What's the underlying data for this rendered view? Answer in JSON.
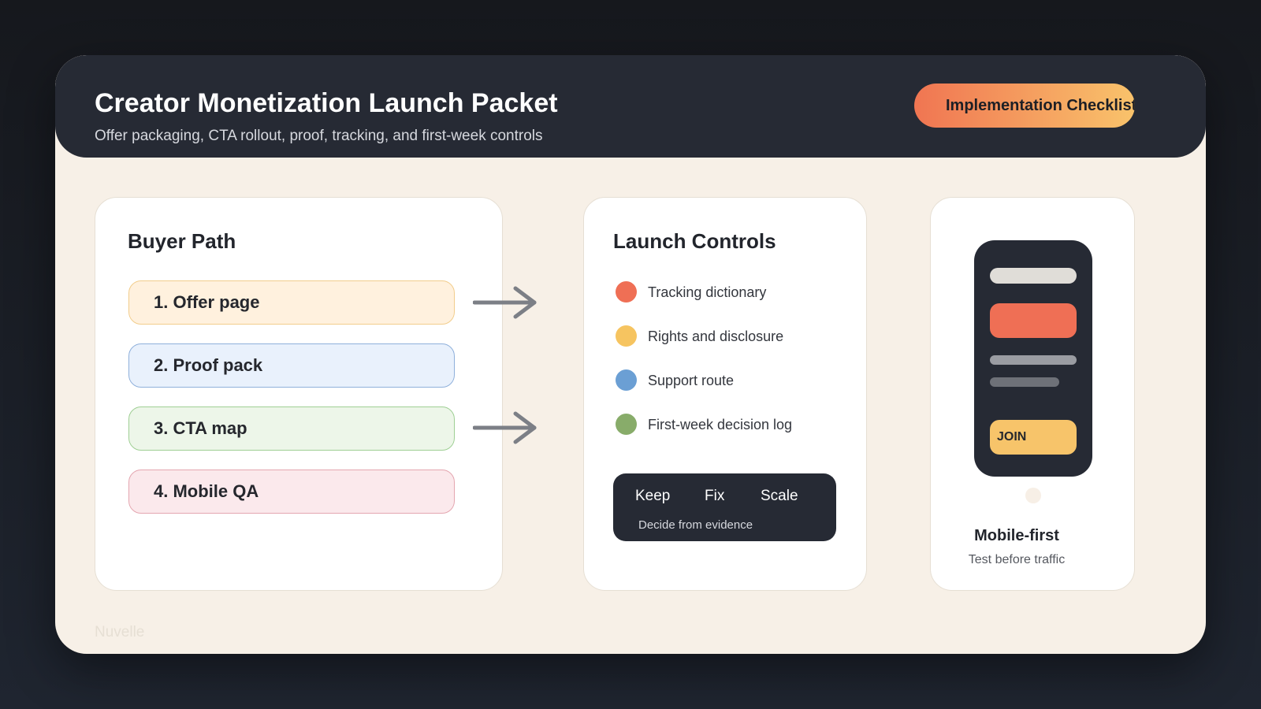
{
  "header": {
    "title": "Creator Monetization Launch Packet",
    "subtitle": "Offer packaging, CTA rollout, proof, tracking, and first-week controls",
    "badge": "Implementation Checklist"
  },
  "buyer_path": {
    "title": "Buyer Path",
    "steps": [
      {
        "label": "1. Offer page",
        "bg": "#fff1de",
        "border": "#f2cd8c"
      },
      {
        "label": "2. Proof pack",
        "bg": "#e9f1fc",
        "border": "#8fb0db"
      },
      {
        "label": "3. CTA map",
        "bg": "#edf6e9",
        "border": "#9fcf94"
      },
      {
        "label": "4. Mobile QA",
        "bg": "#fbe9ec",
        "border": "#e4a6b0"
      }
    ],
    "arrow_icon": "arrow-right-icon"
  },
  "launch_controls": {
    "title": "Launch Controls",
    "items": [
      {
        "label": "Tracking dictionary",
        "color": "#ef6f55"
      },
      {
        "label": "Rights and disclosure",
        "color": "#f6c460"
      },
      {
        "label": "Support route",
        "color": "#6b9fd4"
      },
      {
        "label": "First-week decision log",
        "color": "#88ac6a"
      }
    ],
    "decision": {
      "words": [
        "Keep",
        "Fix",
        "Scale"
      ],
      "caption": "Decide from evidence"
    }
  },
  "mobile": {
    "join_label": "JOIN",
    "title": "Mobile-first",
    "subtitle": "Test before traffic"
  },
  "brand": "Nuvelle",
  "colors": {
    "dark": "#262a34",
    "cream": "#f7f0e7",
    "accent_orange": "#f07552",
    "accent_yellow": "#f9c36b"
  }
}
